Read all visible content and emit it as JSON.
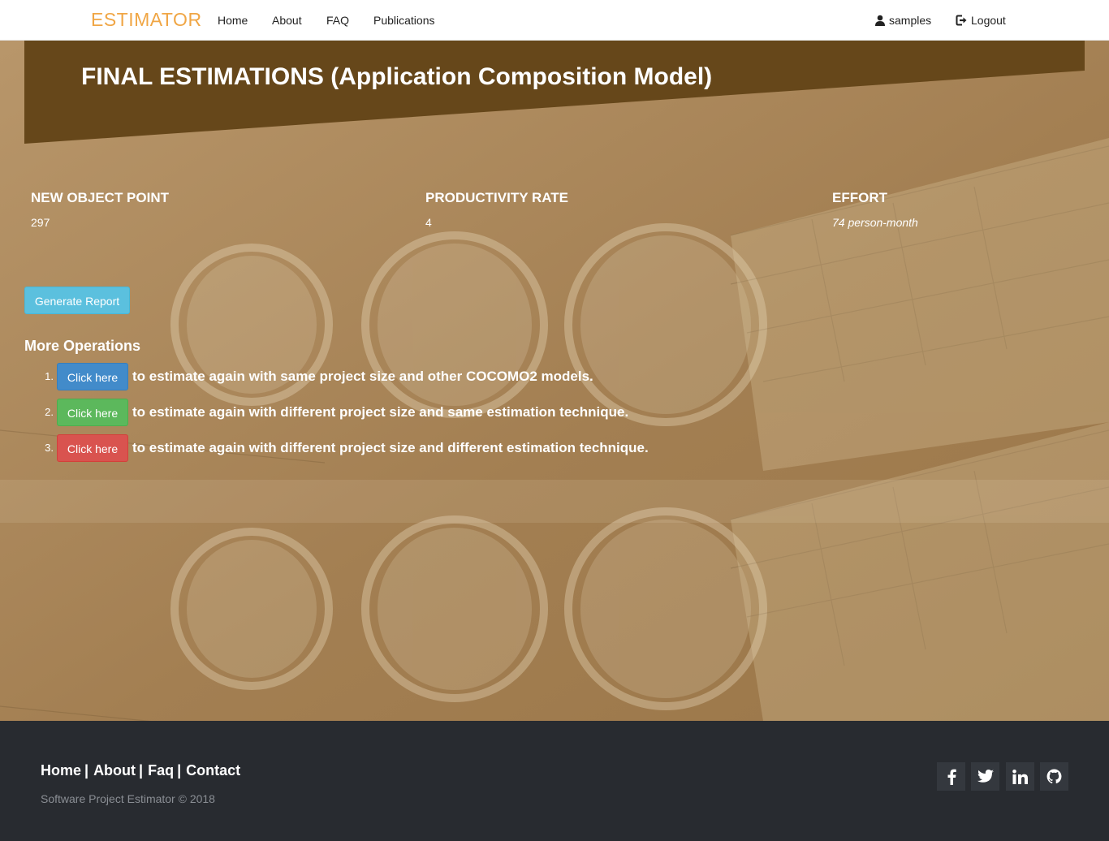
{
  "navbar": {
    "brand": "ESTIMATOR",
    "links": [
      "Home",
      "About",
      "FAQ",
      "Publications"
    ],
    "user_label": "samples",
    "logout_label": "Logout",
    "user_icon": "user-icon",
    "logout_icon": "logout-icon"
  },
  "page": {
    "title": "FINAL ESTIMATIONS (Application Composition Model)"
  },
  "metrics": [
    {
      "label": "NEW OBJECT POINT",
      "value": "297"
    },
    {
      "label": "PRODUCTIVITY RATE",
      "value": "4"
    },
    {
      "label": "EFFORT",
      "value": "74 person-month"
    }
  ],
  "report_button": "Generate Report",
  "more_operations": {
    "title": "More Operations",
    "items": [
      {
        "number": "1.",
        "button": "Click here",
        "text": "to estimate again with same project size and other COCOMO2 models.",
        "color": "#428bca"
      },
      {
        "number": "2.",
        "button": "Click here",
        "text": "to estimate again with different project size and same estimation technique.",
        "color": "#5cb85c"
      },
      {
        "number": "3.",
        "button": "Click here",
        "text": "to estimate again with different project size and different estimation technique.",
        "color": "#d9534f"
      }
    ]
  },
  "footer": {
    "links": [
      "Home",
      "About",
      "Faq",
      "Contact"
    ],
    "copyright": "Software Project Estimator © 2018",
    "social_icons": [
      "facebook-icon",
      "twitter-icon",
      "linkedin-icon",
      "github-icon"
    ]
  },
  "colors": {
    "brand": "#f0a645",
    "banner": "#66471a",
    "hero_tint": "#a88658",
    "footer_bg": "#282b30",
    "info": "#5bc0de"
  }
}
